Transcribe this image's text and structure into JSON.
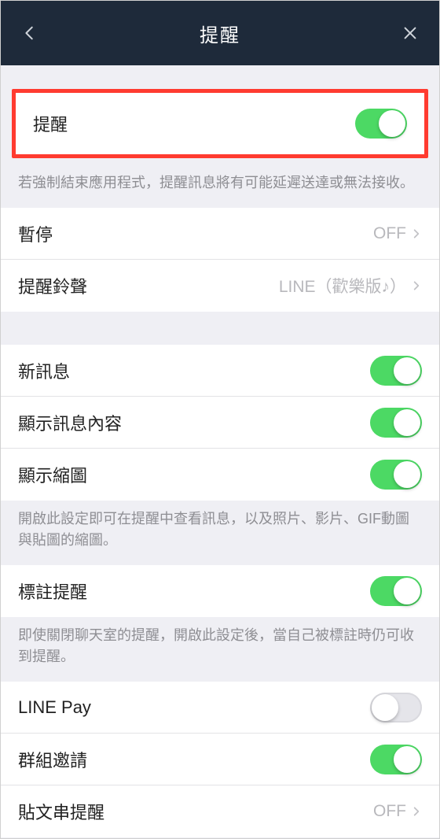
{
  "header": {
    "title": "提醒"
  },
  "rows": {
    "notifications": {
      "label": "提醒",
      "on": true
    },
    "notifications_note": "若強制結束應用程式，提醒訊息將有可能延遲送達或無法接收。",
    "pause": {
      "label": "暫停",
      "value": "OFF"
    },
    "sound": {
      "label": "提醒鈴聲",
      "value": "LINE（歡樂版♪）"
    },
    "new_msg": {
      "label": "新訊息",
      "on": true
    },
    "preview": {
      "label": "顯示訊息內容",
      "on": true
    },
    "thumb": {
      "label": "顯示縮圖",
      "on": true
    },
    "thumb_note": "開啟此設定即可在提醒中查看訊息，以及照片、影片、GIF動圖與貼圖的縮圖。",
    "mention": {
      "label": "標註提醒",
      "on": true
    },
    "mention_note": "即使關閉聊天室的提醒，開啟此設定後，當自己被標註時仍可收到提醒。",
    "linepay": {
      "label": "LINE Pay",
      "on": false
    },
    "group": {
      "label": "群組邀請",
      "on": true
    },
    "timeline": {
      "label": "貼文串提醒",
      "value": "OFF"
    }
  }
}
